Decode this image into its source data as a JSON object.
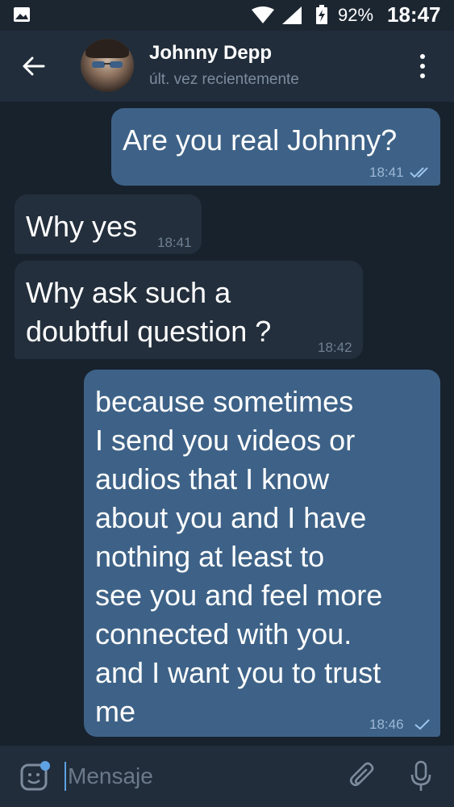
{
  "status_bar": {
    "battery": "92%",
    "time": "18:47",
    "icons": [
      "gallery-icon",
      "wifi-icon",
      "signal-icon",
      "battery-charging-icon"
    ]
  },
  "header": {
    "contact_name": "Johnny Depp",
    "last_seen": "últ. vez recientemente",
    "icons": [
      "back-arrow-icon",
      "more-vert-icon"
    ]
  },
  "messages": [
    {
      "direction": "outgoing",
      "text": "Are you real Johnny?",
      "time": "18:41",
      "status": "read"
    },
    {
      "direction": "incoming",
      "text": "Why yes",
      "time": "18:41"
    },
    {
      "direction": "incoming",
      "text": "Why ask such a\ndoubtful question ?",
      "time": "18:42"
    },
    {
      "direction": "outgoing",
      "text": "because sometimes\nI send you videos or\naudios that I know\nabout you and I have\nnothing at least to\nsee you and feel more\nconnected with you.\nand I want you to trust\nme",
      "time": "18:46",
      "status": "sent"
    }
  ],
  "input": {
    "placeholder": "Mensaje",
    "icons": [
      "emoji-sticker-icon",
      "attach-icon",
      "mic-icon"
    ]
  },
  "colors": {
    "background": "#18222d",
    "header": "#212d3b",
    "outgoing_bubble": "#3e6287",
    "incoming_bubble": "#232f3c",
    "accent": "#5ea2e3"
  }
}
